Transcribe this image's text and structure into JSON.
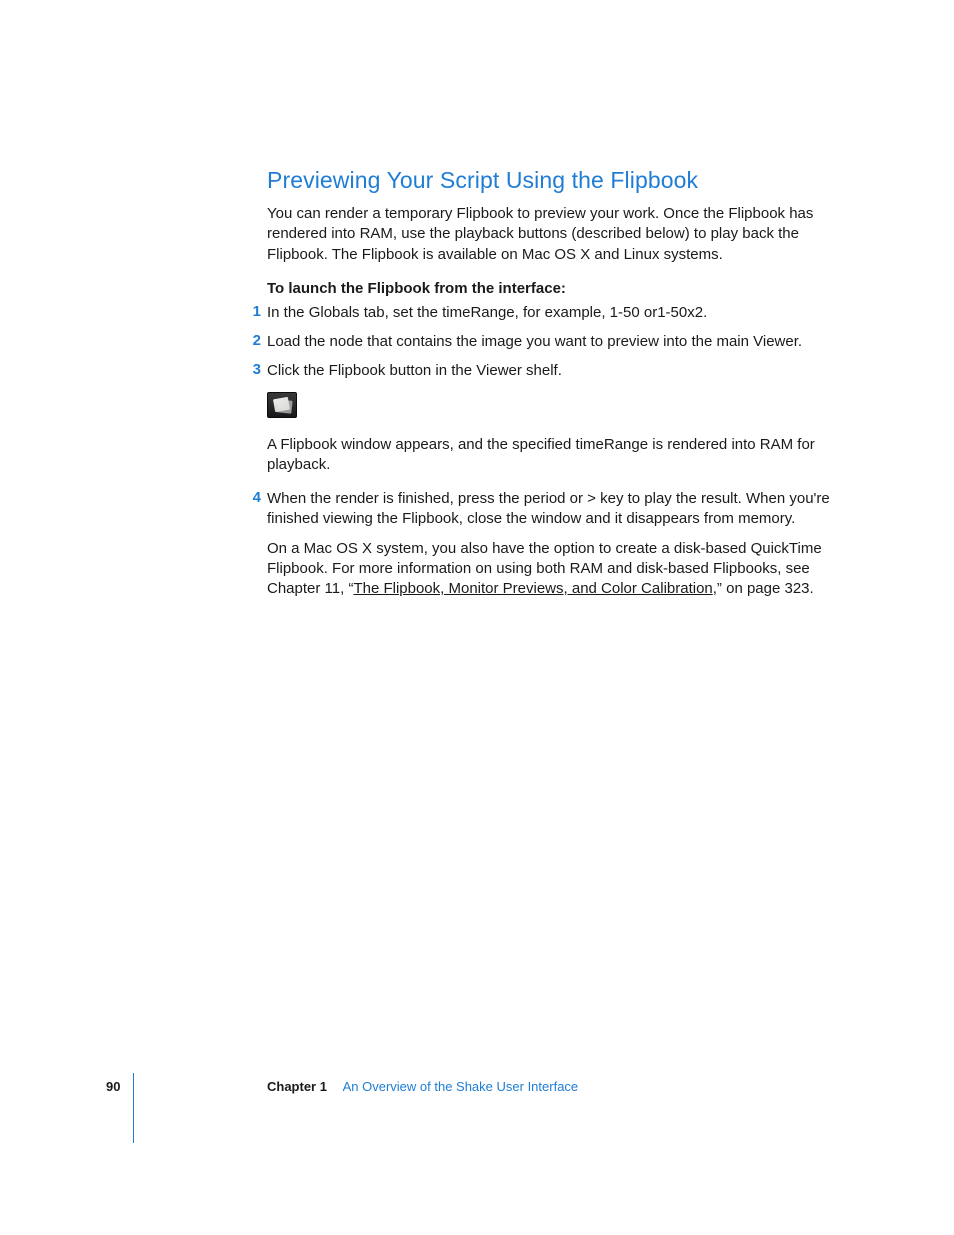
{
  "heading": "Previewing Your Script Using the Flipbook",
  "intro": "You can render a temporary Flipbook to preview your work. Once the Flipbook has rendered into RAM, use the playback buttons (described below) to play back the Flipbook. The Flipbook is available on Mac OS X and Linux systems.",
  "launch_label": "To launch the Flipbook from the interface:",
  "steps": {
    "n1": "1",
    "s1": "In the Globals tab, set the timeRange, for example, 1-50 or1-50x2.",
    "n2": "2",
    "s2": "Load the node that contains the image you want to preview into the main Viewer.",
    "n3": "3",
    "s3": "Click the Flipbook button in the Viewer shelf.",
    "after_icon": "A Flipbook window appears, and the specified timeRange is rendered into RAM for playback.",
    "n4": "4",
    "s4": "When the render is finished, press the period or > key to play the result. When you're finished viewing the Flipbook, close the window and it disappears from memory."
  },
  "macnote_pre": "On a Mac OS X system, you also have the option to create a disk-based QuickTime Flipbook. For more information on using both RAM and disk-based Flipbooks, see Chapter 11, “",
  "macnote_link": "The Flipbook, Monitor Previews, and Color Calibration",
  "macnote_post": ",” on page 323.",
  "footer": {
    "page": "90",
    "chapter_label": "Chapter 1",
    "chapter_title": "An Overview of the Shake User Interface"
  }
}
